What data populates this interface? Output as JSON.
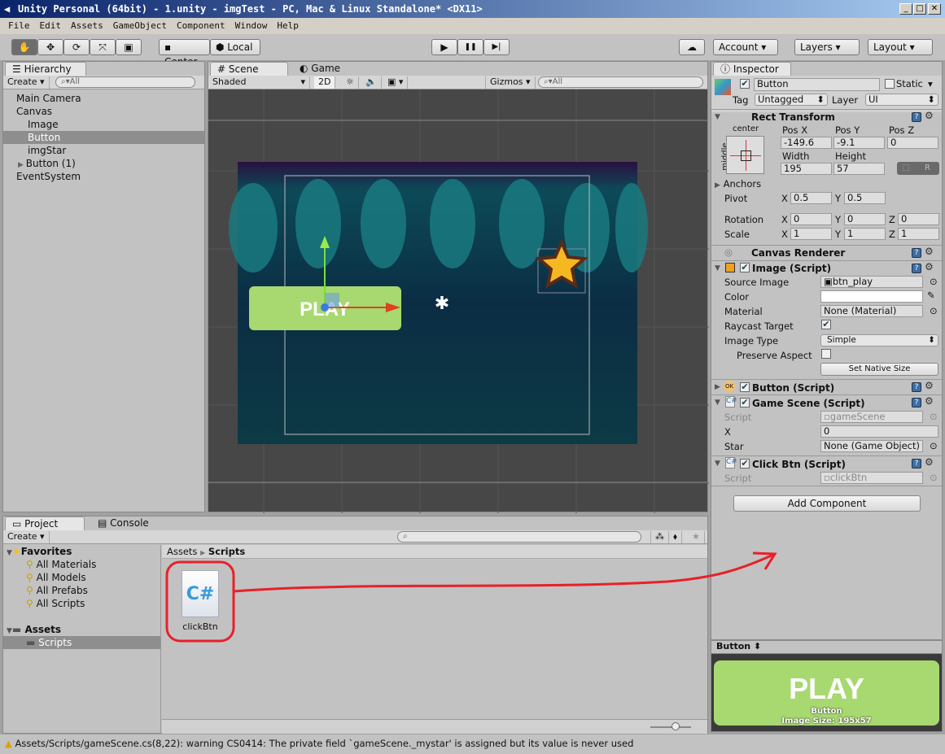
{
  "window": {
    "title": "Unity Personal (64bit) - 1.unity - imgTest - PC, Mac & Linux Standalone* <DX11>",
    "min": "_",
    "max": "□",
    "close": "✕"
  },
  "menu": [
    "File",
    "Edit",
    "Assets",
    "GameObject",
    "Component",
    "Window",
    "Help"
  ],
  "toolbar": {
    "tools": [
      "hand-tool",
      "move-tool",
      "rotate-tool",
      "scale-tool",
      "rect-tool"
    ],
    "tool_glyphs": [
      "✋",
      "✥",
      "⟳",
      "⤧",
      "▣"
    ],
    "pivot": "Center",
    "space": "Local",
    "play": "▶",
    "pause": "❚❚",
    "step": "▶|",
    "cloud": "☁",
    "account": "Account",
    "layers": "Layers",
    "layout": "Layout"
  },
  "hierarchy": {
    "tab": "Hierarchy",
    "create": "Create",
    "search": "All",
    "items": [
      {
        "label": "Main Camera",
        "indent": 0
      },
      {
        "label": "Canvas",
        "indent": 0
      },
      {
        "label": "Image",
        "indent": 1
      },
      {
        "label": "Button",
        "indent": 1,
        "selected": true
      },
      {
        "label": "imgStar",
        "indent": 1
      },
      {
        "label": "Button (1)",
        "indent": 1,
        "collapsed": true
      },
      {
        "label": "EventSystem",
        "indent": 0
      }
    ]
  },
  "scene": {
    "tab_scene": "Scene",
    "tab_game": "Game",
    "shading": "Shaded",
    "mode_2d": "2D",
    "gizmos": "Gizmos",
    "search": "All",
    "button_text": "PLAY"
  },
  "inspector": {
    "tab": "Inspector",
    "object_name": "Button",
    "active": true,
    "static_label": "Static",
    "tag_label": "Tag",
    "tag": "Untagged",
    "layer_label": "Layer",
    "layer": "UI",
    "rect_transform": {
      "title": "Rect Transform",
      "anchor_h": "center",
      "anchor_v": "middle",
      "pos_x_label": "Pos X",
      "pos_y_label": "Pos Y",
      "pos_z_label": "Pos Z",
      "pos_x": "-149.6",
      "pos_y": "-9.1",
      "pos_z": "0",
      "width_label": "Width",
      "height_label": "Height",
      "width": "195",
      "height": "57",
      "raw": "R",
      "anchors": "Anchors",
      "pivot": "Pivot",
      "pivot_x": "0.5",
      "pivot_y": "0.5",
      "rotation": "Rotation",
      "rot_x": "0",
      "rot_y": "0",
      "rot_z": "0",
      "scale": "Scale",
      "scale_x": "1",
      "scale_y": "1",
      "scale_z": "1",
      "x": "X",
      "y": "Y",
      "z": "Z"
    },
    "canvas_renderer": "Canvas Renderer",
    "image": {
      "title": "Image (Script)",
      "source_image_label": "Source Image",
      "source_image": "btn_play",
      "color_label": "Color",
      "color": "#ffffff",
      "material_label": "Material",
      "material": "None (Material)",
      "raycast_label": "Raycast Target",
      "raycast": true,
      "image_type_label": "Image Type",
      "image_type": "Simple",
      "preserve_label": "Preserve Aspect",
      "preserve": false,
      "native_size": "Set Native Size"
    },
    "button_script": "Button (Script)",
    "game_scene": {
      "title": "Game Scene (Script)",
      "script_label": "Script",
      "script": "gameScene",
      "x_label": "X",
      "x": "0",
      "star_label": "Star",
      "star": "None (Game Object)"
    },
    "click_btn": {
      "title": "Click Btn (Script)",
      "script_label": "Script",
      "script": "clickBtn"
    },
    "add_component": "Add Component"
  },
  "preview": {
    "title": "Button",
    "button_text": "PLAY",
    "caption": "Button",
    "size": "Image Size: 195x57"
  },
  "project": {
    "tab_project": "Project",
    "tab_console": "Console",
    "create": "Create",
    "favorites": "Favorites",
    "fav_items": [
      "All Materials",
      "All Models",
      "All Prefabs",
      "All Scripts"
    ],
    "assets": "Assets",
    "scripts": "Scripts",
    "breadcrumb": [
      "Assets",
      "Scripts"
    ],
    "file": "clickBtn",
    "file_icon": "C#"
  },
  "status": {
    "icon": "warning-icon",
    "message": "Assets/Scripts/gameScene.cs(8,22): warning CS0414: The private field `gameScene._mystar' is assigned but its value is never used"
  },
  "colors": {
    "annotation": "#e8202a",
    "play_green": "#a8d870",
    "selection": "#8e8e8e"
  }
}
